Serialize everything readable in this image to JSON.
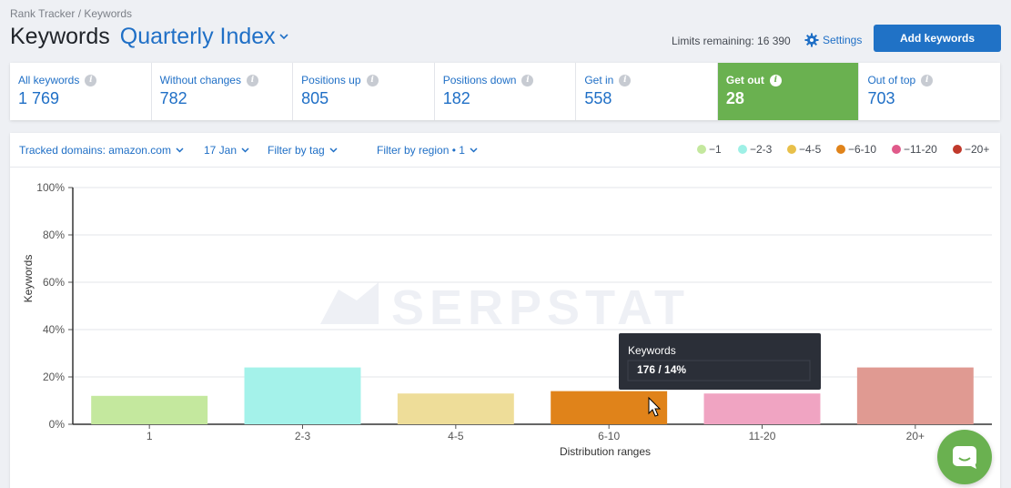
{
  "breadcrumb": "Rank Tracker / Keywords",
  "page_title": "Keywords",
  "project_name": "Quarterly Index",
  "limits_text": "Limits remaining: 16 390",
  "settings_label": "Settings",
  "add_keywords_label": "Add keywords",
  "tabs": [
    {
      "label": "All keywords",
      "value": "1 769"
    },
    {
      "label": "Without changes",
      "value": "782"
    },
    {
      "label": "Positions up",
      "value": "805"
    },
    {
      "label": "Positions down",
      "value": "182"
    },
    {
      "label": "Get in",
      "value": "558"
    },
    {
      "label": "Get out",
      "value": "28",
      "active": true
    },
    {
      "label": "Out of top",
      "value": "703"
    }
  ],
  "filters": {
    "domains": "Tracked domains: amazon.com",
    "date": "17 Jan",
    "tag": "Filter by tag",
    "region": "Filter by region • 1"
  },
  "legend": [
    {
      "label": "−1",
      "color": "#c4e89e"
    },
    {
      "label": "−2-3",
      "color": "#9ef0e6"
    },
    {
      "label": "−4-5",
      "color": "#e8c04a"
    },
    {
      "label": "−6-10",
      "color": "#e0831a"
    },
    {
      "label": "−11-20",
      "color": "#e05a8a"
    },
    {
      "label": "−20+",
      "color": "#c0392b"
    }
  ],
  "watermark": "SERPSTAT",
  "tooltip": {
    "title": "Keywords",
    "value": "176 / 14%"
  },
  "chart_data": {
    "type": "bar",
    "categories": [
      "1",
      "2-3",
      "4-5",
      "6-10",
      "11-20",
      "20+"
    ],
    "values": [
      12,
      24,
      13,
      14,
      13,
      24
    ],
    "colors": [
      "#c4e89e",
      "#a4f2ea",
      "#eedd99",
      "#e0831a",
      "#f0a4c2",
      "#e09a92"
    ],
    "xlabel": "Distribution ranges",
    "ylabel": "Keywords",
    "ylim": [
      0,
      100
    ],
    "yticks": [
      "0%",
      "20%",
      "40%",
      "60%",
      "80%",
      "100%"
    ],
    "grid": true
  }
}
